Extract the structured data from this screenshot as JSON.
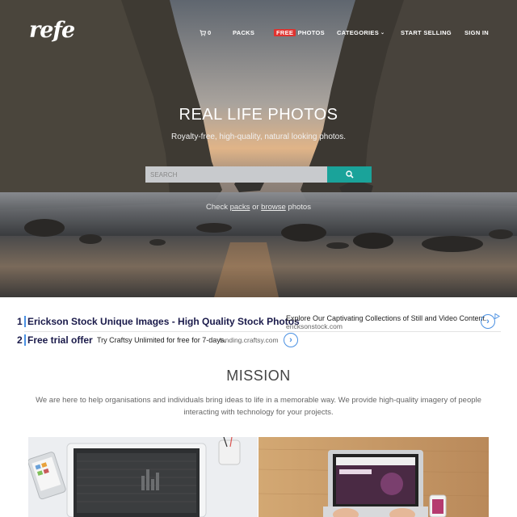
{
  "brand": {
    "logo": "refe"
  },
  "nav": {
    "cart_count": "0",
    "packs": "PACKS",
    "free_badge": "FREE",
    "photos": "PHOTOS",
    "categories": "CATEGORIES",
    "start_selling": "START SELLING",
    "sign_in": "SIGN IN"
  },
  "hero": {
    "title": "REAL LIFE PHOTOS",
    "subtitle": "Royalty-free, high-quality, natural looking photos.",
    "search_placeholder": "SEARCH",
    "links_prefix": "Check ",
    "link_packs": "packs",
    "links_or": " or ",
    "link_browse": "browse",
    "links_suffix": " photos"
  },
  "ads": [
    {
      "number": "1",
      "title": "Erickson Stock Unique Images - High Quality Stock Photos",
      "description": "Explore Our Captivating Collections of Still and Video Content.",
      "url": "ericksonstock.com"
    },
    {
      "number": "2",
      "title": "Free trial offer",
      "description": "Try Craftsy Unlimited for free for 7-days.",
      "url": "landing.craftsy.com"
    }
  ],
  "mission": {
    "title": "MISSION",
    "text": "We are here to help organisations and individuals bring ideas to life in a memorable way. We provide high-quality imagery of people interacting with technology for your projects."
  },
  "colors": {
    "accent": "#1aa39a",
    "free_badge": "#e0332f",
    "ad_title": "#1a1a4a",
    "ad_link": "#4a90e2"
  },
  "icons": [
    "cart-icon",
    "chevron-down-icon",
    "search-icon",
    "chevron-right-icon",
    "adchoices-icon"
  ]
}
